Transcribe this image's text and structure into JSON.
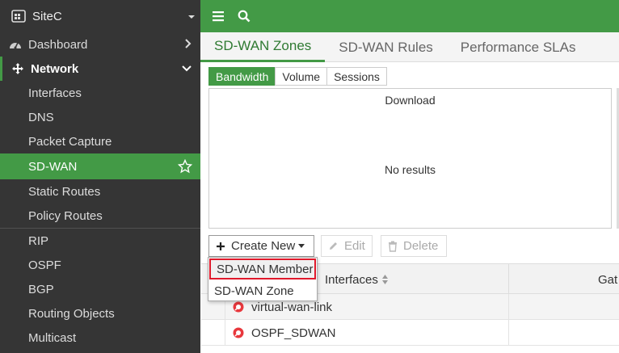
{
  "sidebar": {
    "site": "SiteC",
    "items": [
      {
        "label": "Dashboard"
      },
      {
        "label": "Network"
      },
      {
        "label": "Interfaces"
      },
      {
        "label": "DNS"
      },
      {
        "label": "Packet Capture"
      },
      {
        "label": "SD-WAN"
      },
      {
        "label": "Static Routes"
      },
      {
        "label": "Policy Routes"
      },
      {
        "label": "RIP"
      },
      {
        "label": "OSPF"
      },
      {
        "label": "BGP"
      },
      {
        "label": "Routing Objects"
      },
      {
        "label": "Multicast"
      }
    ]
  },
  "tabs": [
    {
      "label": "SD-WAN Zones"
    },
    {
      "label": "SD-WAN Rules"
    },
    {
      "label": "Performance SLAs"
    }
  ],
  "subtabs": [
    {
      "label": "Bandwidth"
    },
    {
      "label": "Volume"
    },
    {
      "label": "Sessions"
    }
  ],
  "chart": {
    "title": "Download",
    "empty": "No results"
  },
  "toolbar": {
    "create": "Create New",
    "edit": "Edit",
    "delete": "Delete"
  },
  "dropdown": {
    "items": [
      {
        "label": "SD-WAN Member"
      },
      {
        "label": "SD-WAN Zone"
      }
    ]
  },
  "table": {
    "headers": {
      "interfaces": "Interfaces",
      "gateway": "Gat"
    },
    "rows": [
      {
        "name": "virtual-wan-link"
      },
      {
        "name": "OSPF_SDWAN"
      }
    ]
  },
  "colors": {
    "accent": "#439a46",
    "sidebar": "#353535",
    "highlight_border": "#e0192b"
  }
}
